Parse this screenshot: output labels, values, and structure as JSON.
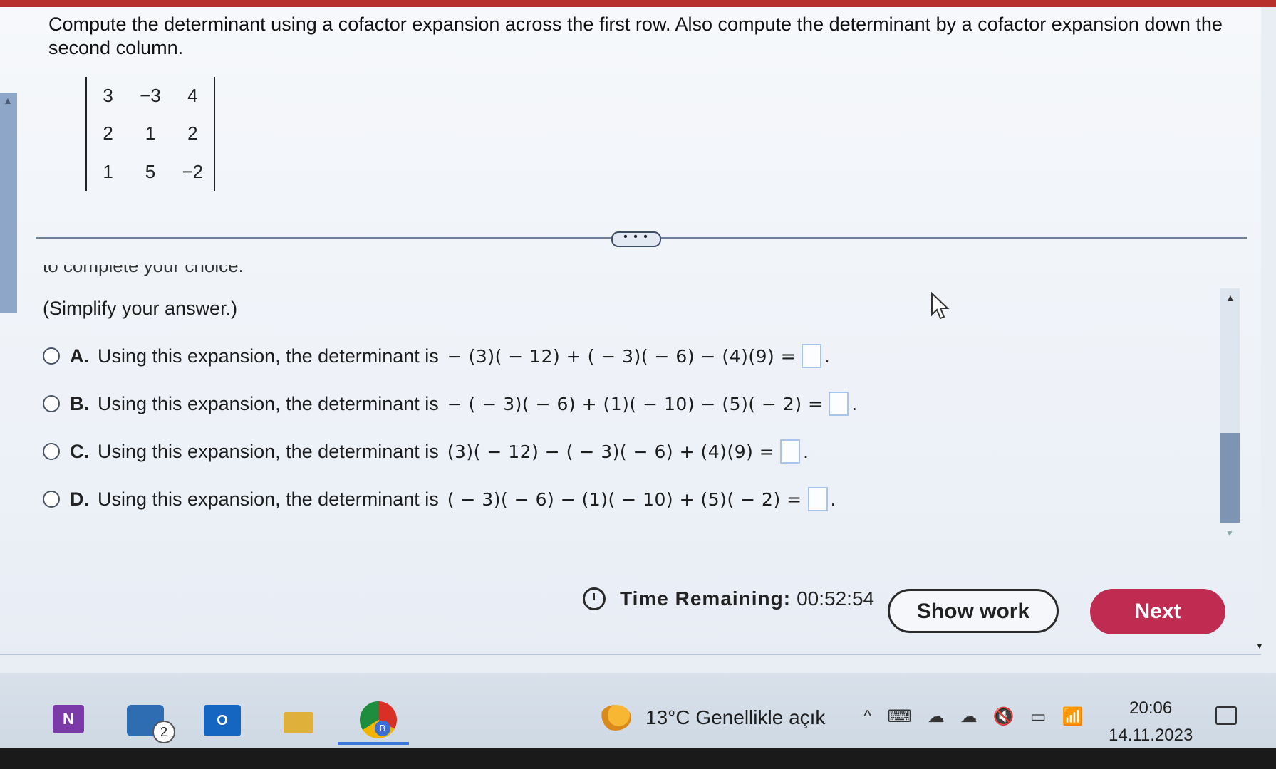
{
  "question": {
    "text": "Compute the determinant using a cofactor expansion across the first row. Also compute the determinant by a cofactor expansion down the second column."
  },
  "matrix": [
    [
      "3",
      "−3",
      "4"
    ],
    [
      "2",
      "1",
      "2"
    ],
    [
      "1",
      "5",
      "−2"
    ]
  ],
  "divider": {
    "more_label": "• • •"
  },
  "partial_instruction": "to complete your choice.",
  "simplify_note": "(Simplify your answer.)",
  "options": [
    {
      "letter": "A.",
      "text": "Using this expansion, the determinant is",
      "expr": "− (3)( − 12) + ( − 3)( − 6) − (4)(9) ="
    },
    {
      "letter": "B.",
      "text": "Using this expansion, the determinant is",
      "expr": "− ( − 3)( − 6) + (1)( − 10) − (5)( − 2) ="
    },
    {
      "letter": "C.",
      "text": "Using this expansion, the determinant is",
      "expr": "(3)( − 12) − ( − 3)( − 6) + (4)(9) ="
    },
    {
      "letter": "D.",
      "text": "Using this expansion, the determinant is",
      "expr": "( − 3)( − 6) − (1)( − 10) + (5)( − 2) ="
    }
  ],
  "footer": {
    "timer_label": "Time Remaining:",
    "timer_value": "00:52:54",
    "show_work_label": "Show work",
    "next_label": "Next"
  },
  "taskbar": {
    "onenote_label": "N",
    "mail_badge": "2",
    "outlook_label": "O",
    "chrome_badge": "B",
    "weather": "13°C  Genellikle açık",
    "tray_icons": [
      "^",
      "⌨",
      "☁",
      "☁",
      "🔇",
      "▭",
      "📶"
    ],
    "time": "20:06",
    "date": "14.11.2023"
  },
  "colors": {
    "next_button": "#c02b52",
    "answer_box_border": "#a9c4ea",
    "top_bar": "#b8302c"
  }
}
